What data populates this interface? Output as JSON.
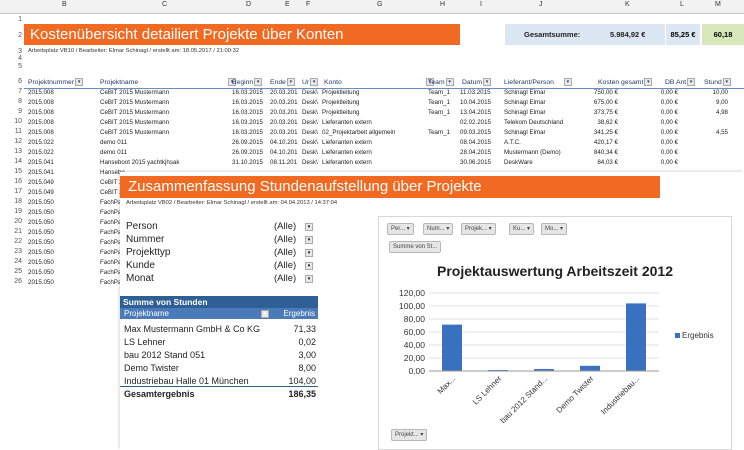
{
  "columns": [
    "B",
    "C",
    "D",
    "E",
    "F",
    "G",
    "H",
    "I",
    "J",
    "K",
    "L",
    "M"
  ],
  "top": {
    "title": "Kostenübersicht detailiert Projekte über Konten",
    "subtitle": "Arbeitsplatz VB10 / Bearbeiter: Elmar Schinagl / erstellt am: 18.05.2017 / 21:00:32",
    "total_label": "Gesamtsumme:",
    "total_value": "5.984,92 €",
    "total_db": "85,25 €",
    "total_hours": "60,18",
    "headers": [
      "Projektnummer",
      "Projektname",
      "Beginn",
      "Ende",
      "Ur",
      "Konto",
      "Team",
      "Datum",
      "Lieferant/Person",
      "Kosten gesamt",
      "DB Ant",
      "Stund"
    ],
    "rows": [
      [
        "2015.008",
        "CeBIT 2015 Mustermann",
        "16.03.2015",
        "20.03.201",
        "Desk\\",
        "Projektleitung",
        "Team_1",
        "11.03.2015",
        "Schinagl Elmar",
        "750,00 €",
        "0,00 €",
        "10,00"
      ],
      [
        "2015.008",
        "CeBIT 2015 Mustermann",
        "16.03.2015",
        "20.03.201",
        "Desk\\",
        "Projektleitung",
        "Team_1",
        "10.04.2015",
        "Schinagl Elmar",
        "675,00 €",
        "0,00 €",
        "9,00"
      ],
      [
        "2015.008",
        "CeBIT 2015 Mustermann",
        "16.03.2015",
        "20.03.201",
        "Desk\\",
        "Projektleitung",
        "Team_1",
        "13.04.2015",
        "Schinagl Elmar",
        "373,75 €",
        "0,00 €",
        "4,98"
      ],
      [
        "2015.008",
        "CeBIT 2015 Mustermann",
        "16.03.2015",
        "20.03.201",
        "Desk\\",
        "Lieferanten extern",
        "",
        "02.02.2015",
        "Telekom Deutschland",
        "38,62 €",
        "0,00 €",
        ""
      ],
      [
        "2015.008",
        "CeBIT 2015 Mustermann",
        "16.03.2015",
        "20.03.201",
        "Desk\\",
        "02_Projektarbeit allgemein",
        "Team_1",
        "09.03.2015",
        "Schinagl Elmar",
        "341,25 €",
        "0,00 €",
        "4,55"
      ],
      [
        "2015.022",
        "demo 011",
        "26.09.2015",
        "04.10.201",
        "Desk\\",
        "Lieferanten extern",
        "",
        "08.04.2015",
        "A.T.C.",
        "420,17 €",
        "0,00 €",
        ""
      ],
      [
        "2015.022",
        "demo 011",
        "26.09.2015",
        "04.10.201",
        "Desk\\",
        "Lieferanten extern",
        "",
        "28.04.2015",
        "Mustermann (Demo)",
        "840,34 €",
        "0,00 €",
        ""
      ],
      [
        "2015.041",
        "Hanseboot 2015 yachtkjhsak",
        "31.10.2015",
        "08.11.201",
        "Desk\\",
        "Lieferanten extern",
        "",
        "30.06.2015",
        "DeskWare",
        "84,03 €",
        "0,00 €",
        ""
      ],
      [
        "2015.041",
        "Hansebo",
        "",
        "",
        "",
        "",
        "",
        "",
        "",
        "",
        "",
        ""
      ],
      [
        "2015.049",
        "CeBIT 2",
        "",
        "",
        "",
        "",
        "",
        "",
        "",
        "",
        "",
        ""
      ],
      [
        "2015.049",
        "CeBIT 2",
        "",
        "",
        "",
        "",
        "",
        "",
        "",
        "",
        "",
        ""
      ],
      [
        "2015.050",
        "FachPa",
        "",
        "",
        "",
        "",
        "",
        "",
        "",
        "",
        "",
        ""
      ],
      [
        "2015.050",
        "FachPa",
        "",
        "",
        "",
        "",
        "",
        "",
        "",
        "",
        "",
        ""
      ],
      [
        "2015.050",
        "FachPa",
        "",
        "",
        "",
        "",
        "",
        "",
        "",
        "",
        "",
        ""
      ],
      [
        "2015.050",
        "FachPa",
        "",
        "",
        "",
        "",
        "",
        "",
        "",
        "",
        "",
        ""
      ],
      [
        "2015.050",
        "FachPa",
        "",
        "",
        "",
        "",
        "",
        "",
        "",
        "",
        "",
        ""
      ],
      [
        "2015.050",
        "FachPa",
        "",
        "",
        "",
        "",
        "",
        "",
        "",
        "",
        "",
        ""
      ],
      [
        "2015.050",
        "FachPa",
        "",
        "",
        "",
        "",
        "",
        "",
        "",
        "",
        "",
        ""
      ],
      [
        "2015.050",
        "FachPa",
        "",
        "",
        "",
        "",
        "",
        "",
        "",
        "",
        "",
        ""
      ],
      [
        "2015.050",
        "FachPa",
        "",
        "",
        "",
        "",
        "",
        "",
        "",
        "",
        "",
        ""
      ]
    ]
  },
  "overlay": {
    "title": "Zusammenfassung Stundenaufstellung über Projekte",
    "subtitle": "Arbeitsplatz VB02 / Bearbeiter: Elmar Schinagl / erstellt am: 04.04.2013 / 14:37:04",
    "filters": [
      {
        "label": "Person",
        "value": "(Alle)"
      },
      {
        "label": "Nummer",
        "value": "(Alle)"
      },
      {
        "label": "Projekttyp",
        "value": "(Alle)"
      },
      {
        "label": "Kunde",
        "value": "(Alle)"
      },
      {
        "label": "Monat",
        "value": "(Alle)"
      }
    ],
    "pivot_title": "Summe von Stunden",
    "pivot_col1": "Projektname",
    "pivot_col2": "Ergebnis",
    "pivot_rows": [
      {
        "name": "Max Mustermann GmbH & Co KG",
        "value": "71,33"
      },
      {
        "name": "LS Lehner",
        "value": "0,02"
      },
      {
        "name": "bau 2012 Stand 051",
        "value": "3,00"
      },
      {
        "name": "Demo Twister",
        "value": "8,00"
      },
      {
        "name": "Industriebau Halle 01 München",
        "value": "104,00"
      }
    ],
    "total_label": "Gesamtergebnis",
    "total_value": "186,35"
  },
  "chart_buttons": [
    "Per...",
    "Num...",
    "Projek...",
    "Ku...",
    "Mo..."
  ],
  "chart_value_button": "Summe von St...",
  "chart_bottom_button": "Projekt...",
  "chart_data": {
    "type": "bar",
    "title": "Projektauswertung Arbeitszeit 2012",
    "categories": [
      "Max...",
      "LS Lehner",
      "bau 2012 Stand...",
      "Demo Twister",
      "Industriebau..."
    ],
    "series": [
      {
        "name": "Ergebnis",
        "values": [
          71.33,
          0.02,
          3.0,
          8.0,
          104.0
        ]
      }
    ],
    "yticks": [
      "0,00",
      "20,00",
      "40,00",
      "60,00",
      "80,00",
      "100,00",
      "120,00"
    ],
    "ylim": [
      0,
      120
    ],
    "legend": "right",
    "bar_color": "#3a70c0"
  }
}
